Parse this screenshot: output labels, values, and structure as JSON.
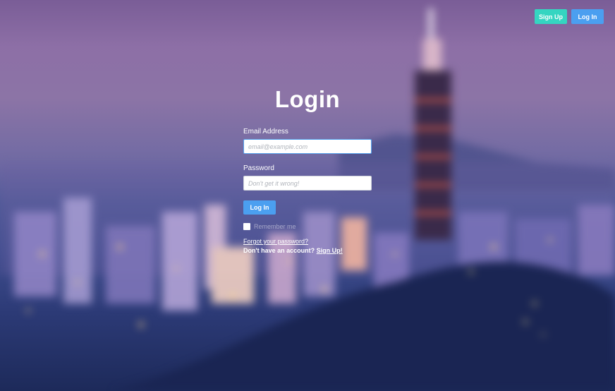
{
  "header": {
    "signup_label": "Sign Up",
    "login_label": "Log In"
  },
  "page": {
    "title": "Login"
  },
  "form": {
    "email_label": "Email Address",
    "email_placeholder": "email@example.com",
    "password_label": "Password",
    "password_placeholder": "Don't get it wrong!",
    "login_button": "Log In",
    "remember_label": "Remember me",
    "forgot_link": "Forgot your password?",
    "no_account_text": "Don't have an account?",
    "signup_link": "Sign Up!"
  },
  "colors": {
    "signup_button": "#35d5c1",
    "login_button": "#4b9ff0",
    "input_focus_border": "#59a5ef"
  },
  "icons": [
    "checkbox"
  ]
}
